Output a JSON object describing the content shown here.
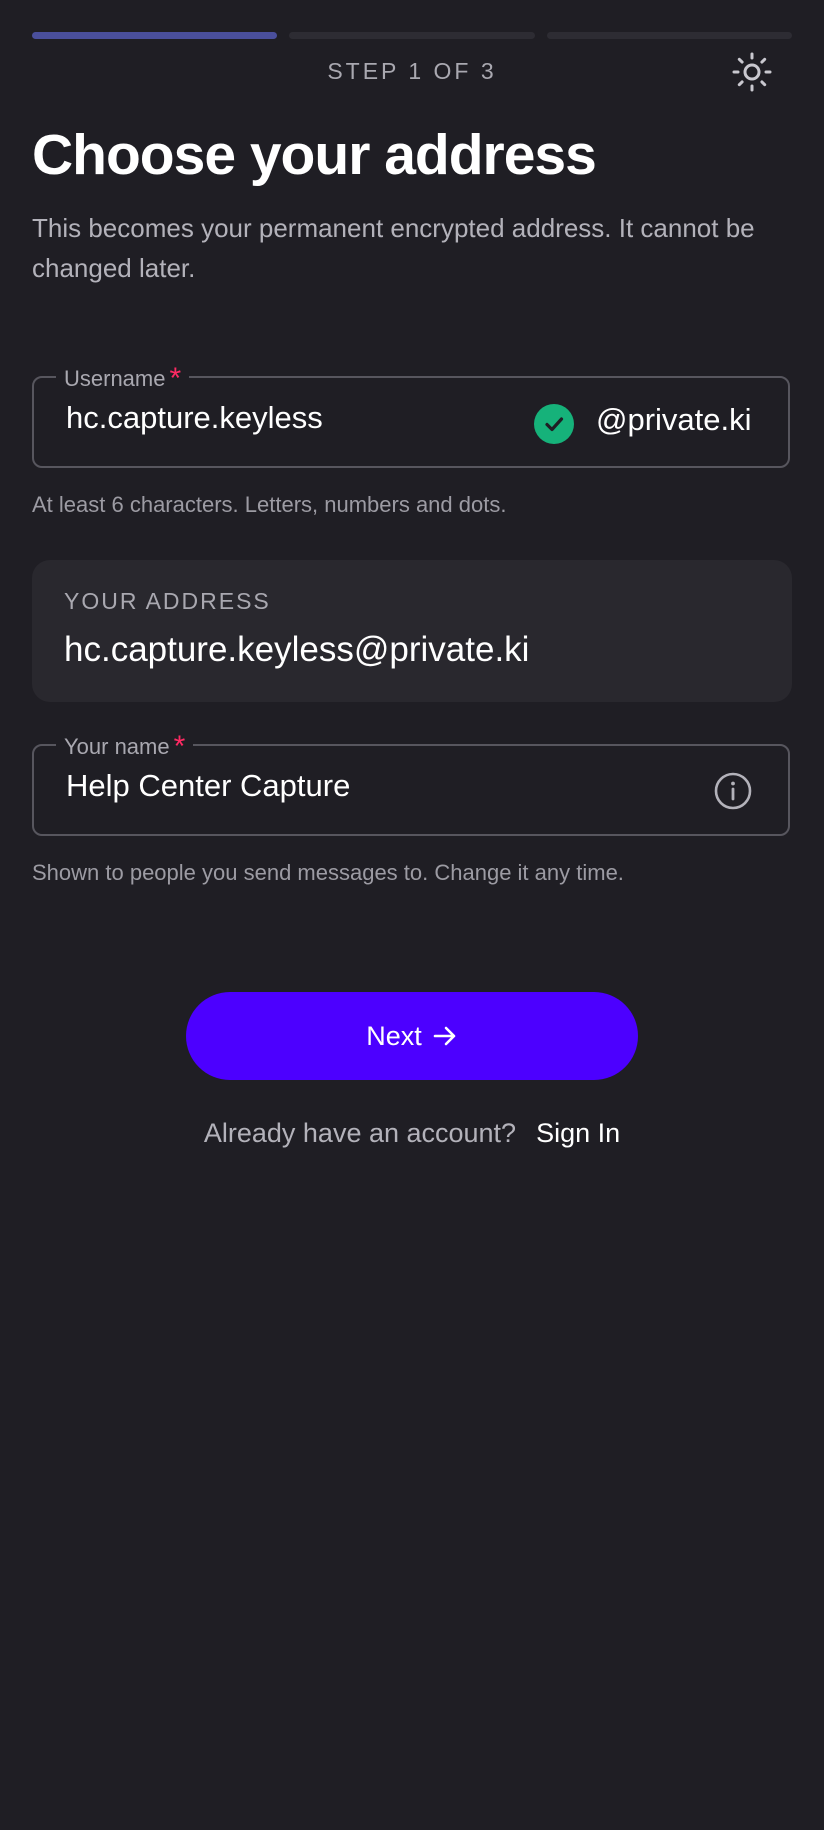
{
  "progress": {
    "step_label": "STEP 1 OF 3",
    "total_steps": 3,
    "current_step": 1
  },
  "header": {
    "title": "Choose your address",
    "subtitle": "This becomes your permanent encrypted address. It cannot be changed later."
  },
  "username": {
    "label": "Username",
    "required_mark": "*",
    "value": "hc.capture.keyless",
    "domain": "@private.ki",
    "status": "valid",
    "hint": "At least 6 characters. Letters, numbers and dots."
  },
  "address": {
    "label": "YOUR ADDRESS",
    "value": "hc.capture.keyless@private.ki"
  },
  "name": {
    "label": "Your name",
    "required_mark": "*",
    "value": "Help Center Capture",
    "hint": "Shown to people you send messages to. Change it any time."
  },
  "actions": {
    "next_label": "Next",
    "signin_prompt": "Already have an account?",
    "signin_label": "Sign In"
  },
  "colors": {
    "background": "#1f1e24",
    "accent": "#4c00ff",
    "progress_active": "#4a4f9c",
    "required": "#ff2a63",
    "valid": "#16b27a"
  },
  "icons": {
    "theme": "sun-icon",
    "valid": "check-circle-icon",
    "info": "info-icon",
    "next": "arrow-right-icon"
  }
}
